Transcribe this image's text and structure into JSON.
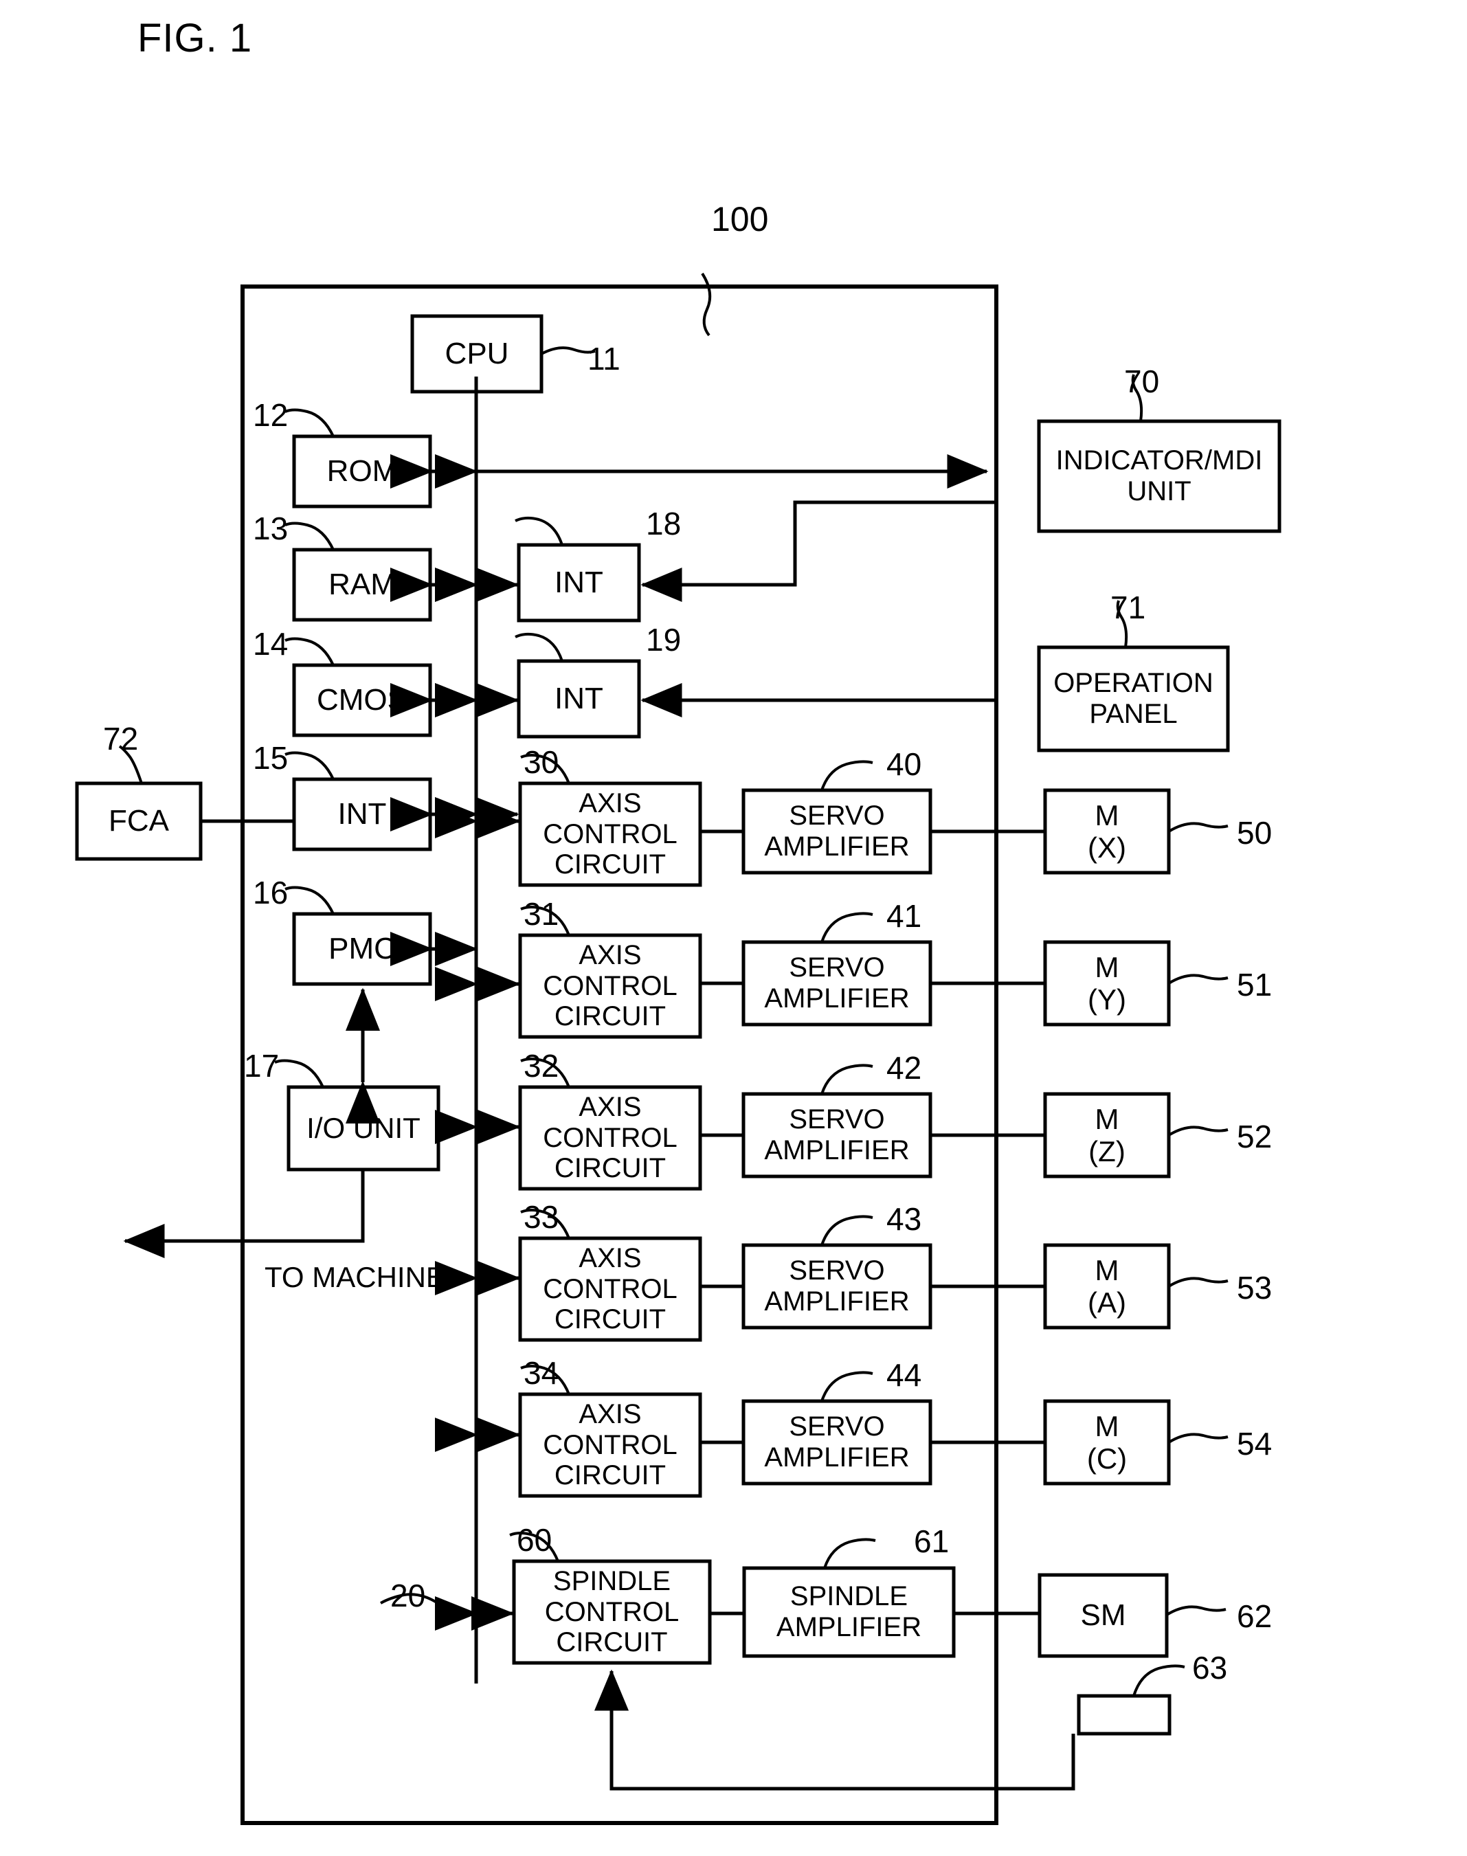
{
  "figure": {
    "title": "FIG. 1",
    "system_ref": "100",
    "bus_ref": "20",
    "to_machine_label": "TO MACHINE"
  },
  "blocks": {
    "cpu": {
      "label": "CPU",
      "ref": "11"
    },
    "rom": {
      "label": "ROM",
      "ref": "12"
    },
    "ram": {
      "label": "RAM",
      "ref": "13"
    },
    "cmos": {
      "label": "CMOS",
      "ref": "14"
    },
    "int15": {
      "label": "INT",
      "ref": "15"
    },
    "pmc": {
      "label": "PMC",
      "ref": "16"
    },
    "io_unit": {
      "label": "I/O UNIT",
      "ref": "17"
    },
    "int18": {
      "label": "INT",
      "ref": "18"
    },
    "int19": {
      "label": "INT",
      "ref": "19"
    },
    "fca": {
      "label": "FCA",
      "ref": "72"
    },
    "indicator": {
      "label": "INDICATOR/MDI\nUNIT",
      "ref": "70"
    },
    "operation": {
      "label": "OPERATION\nPANEL",
      "ref": "71"
    },
    "spindle_ctrl": {
      "label": "SPINDLE\nCONTROL\nCIRCUIT",
      "ref": "60"
    },
    "spindle_amp": {
      "label": "SPINDLE\nAMPLIFIER",
      "ref": "61"
    },
    "sm": {
      "label": "SM",
      "ref": "62"
    },
    "encoder": {
      "label": "",
      "ref": "63"
    }
  },
  "axis_rows": [
    {
      "axis_label": "AXIS\nCONTROL\nCIRCUIT",
      "axis_ref": "30",
      "servo_label": "SERVO\nAMPLIFIER",
      "servo_ref": "40",
      "motor_label": "M\n(X)",
      "motor_ref": "50"
    },
    {
      "axis_label": "AXIS\nCONTROL\nCIRCUIT",
      "axis_ref": "31",
      "servo_label": "SERVO\nAMPLIFIER",
      "servo_ref": "41",
      "motor_label": "M\n(Y)",
      "motor_ref": "51"
    },
    {
      "axis_label": "AXIS\nCONTROL\nCIRCUIT",
      "axis_ref": "32",
      "servo_label": "SERVO\nAMPLIFIER",
      "servo_ref": "42",
      "motor_label": "M\n(Z)",
      "motor_ref": "52"
    },
    {
      "axis_label": "AXIS\nCONTROL\nCIRCUIT",
      "axis_ref": "33",
      "servo_label": "SERVO\nAMPLIFIER",
      "servo_ref": "43",
      "motor_label": "M\n(A)",
      "motor_ref": "53"
    },
    {
      "axis_label": "AXIS\nCONTROL\nCIRCUIT",
      "axis_ref": "34",
      "servo_label": "SERVO\nAMPLIFIER",
      "servo_ref": "44",
      "motor_label": "M\n(C)",
      "motor_ref": "54"
    }
  ],
  "colors": {
    "ink": "#000000",
    "paper": "#ffffff"
  }
}
